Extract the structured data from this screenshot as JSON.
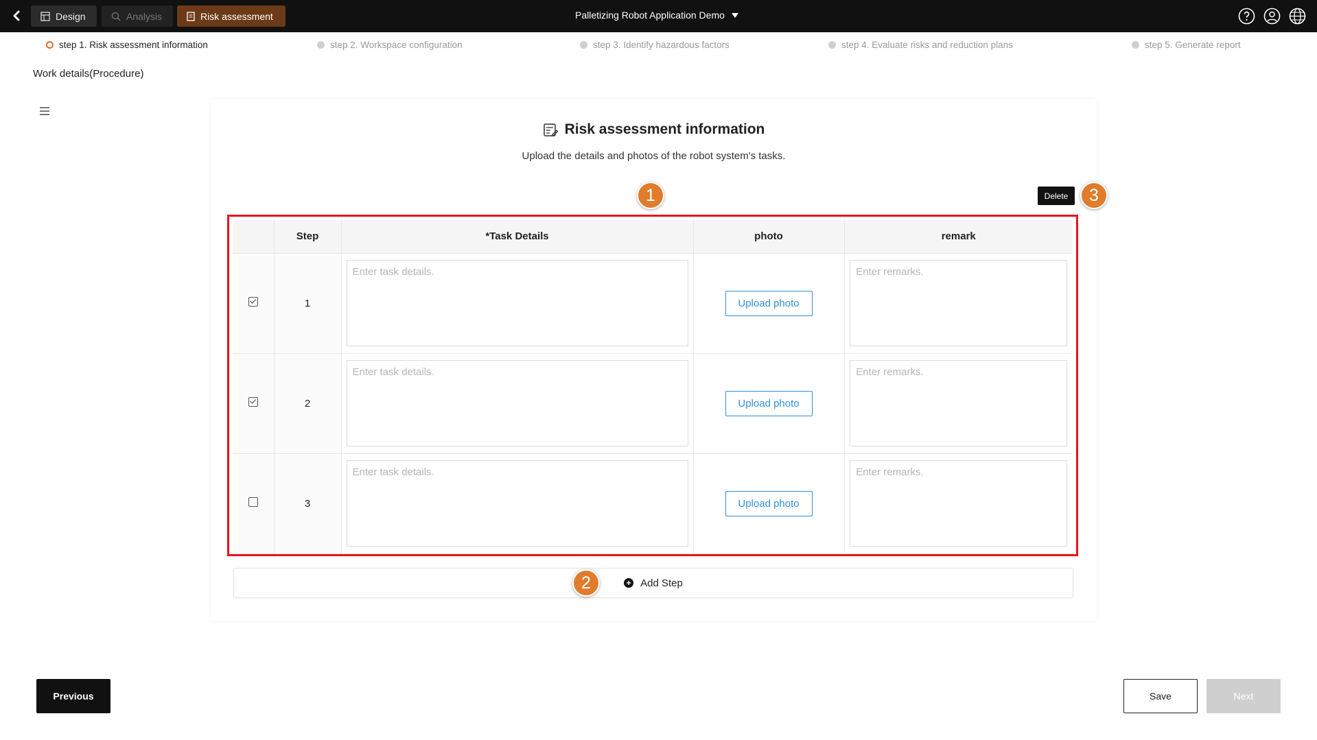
{
  "topbar": {
    "tabs": [
      {
        "label": "Design",
        "icon": "design-icon"
      },
      {
        "label": "Analysis",
        "icon": "analysis-icon"
      },
      {
        "label": "Risk assessment",
        "icon": "document-icon"
      }
    ],
    "project_title": "Palletizing Robot Application Demo",
    "active_tab_color": "#6b3a17"
  },
  "stepper": {
    "steps": [
      {
        "label": "step 1. Risk assessment information",
        "active": true
      },
      {
        "label": "step 2. Workspace configuration",
        "active": false
      },
      {
        "label": "step 3. Identify hazardous factors",
        "active": false
      },
      {
        "label": "step 4. Evaluate risks and reduction plans",
        "active": false
      },
      {
        "label": "step 5. Generate report",
        "active": false
      }
    ],
    "active_color": "#f06a2a"
  },
  "page": {
    "subtitle": "Work details(Procedure)"
  },
  "card": {
    "title": "Risk assessment information",
    "description": "Upload the details and photos of the robot system's tasks.",
    "delete_label": "Delete"
  },
  "table": {
    "columns": [
      "",
      "Step",
      "*Task Details",
      "photo",
      "remark"
    ],
    "rows": [
      {
        "step": "1",
        "checked": true,
        "task_placeholder": "Enter task details.",
        "photo_label": "Upload photo",
        "remark_placeholder": "Enter remarks."
      },
      {
        "step": "2",
        "checked": true,
        "task_placeholder": "Enter task details.",
        "photo_label": "Upload photo",
        "remark_placeholder": "Enter remarks."
      },
      {
        "step": "3",
        "checked": false,
        "task_placeholder": "Enter task details.",
        "photo_label": "Upload photo",
        "remark_placeholder": "Enter remarks."
      }
    ],
    "highlight_color": "#e8141c"
  },
  "add_step_label": "Add Step",
  "markers": [
    "1",
    "2",
    "3"
  ],
  "marker_color": "#e07c2c",
  "footer": {
    "previous_label": "Previous",
    "save_label": "Save",
    "next_label": "Next"
  }
}
